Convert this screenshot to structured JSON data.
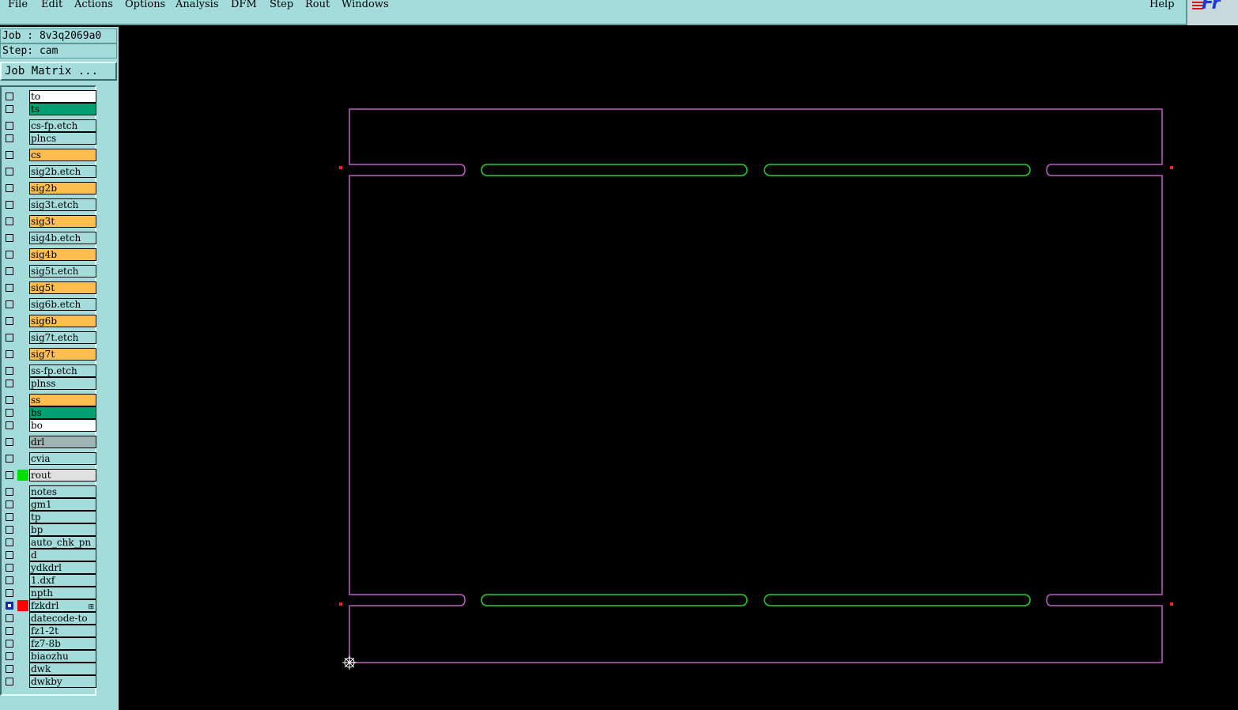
{
  "menubar": {
    "items": [
      "File",
      "Edit",
      "Actions",
      "Options",
      "Analysis",
      "DFM",
      "Step",
      "Rout",
      "Windows"
    ],
    "help": "Help",
    "logo": "Fr"
  },
  "job": {
    "label": "Job : 8v3q2069a0"
  },
  "step": {
    "label": "Step: cam"
  },
  "job_matrix_button": "Job Matrix ...",
  "layers": [
    {
      "name": "to",
      "color": "#ffffff"
    },
    {
      "name": "ts",
      "color": "#00a070"
    },
    {
      "name": "cs-fp.etch",
      "color": "#a4dcdc"
    },
    {
      "name": "plncs",
      "color": "#a4dcdc"
    },
    {
      "name": "cs",
      "color": "#ffbe50"
    },
    {
      "name": "sig2b.etch",
      "color": "#a4dcdc"
    },
    {
      "name": "sig2b",
      "color": "#ffbe50"
    },
    {
      "name": "sig3t.etch",
      "color": "#a4dcdc"
    },
    {
      "name": "sig3t",
      "color": "#ffbe50"
    },
    {
      "name": "sig4b.etch",
      "color": "#a4dcdc"
    },
    {
      "name": "sig4b",
      "color": "#ffbe50"
    },
    {
      "name": "sig5t.etch",
      "color": "#a4dcdc"
    },
    {
      "name": "sig5t",
      "color": "#ffbe50"
    },
    {
      "name": "sig6b.etch",
      "color": "#a4dcdc"
    },
    {
      "name": "sig6b",
      "color": "#ffbe50"
    },
    {
      "name": "sig7t.etch",
      "color": "#a4dcdc"
    },
    {
      "name": "sig7t",
      "color": "#ffbe50"
    },
    {
      "name": "ss-fp.etch",
      "color": "#a4dcdc"
    },
    {
      "name": "plnss",
      "color": "#a4dcdc"
    },
    {
      "name": "ss",
      "color": "#ffbe50"
    },
    {
      "name": "bs",
      "color": "#00a070"
    },
    {
      "name": "bo",
      "color": "#ffffff"
    },
    {
      "name": "drl",
      "color": "#a0b4b4"
    },
    {
      "name": "cvia",
      "color": "#a4dcdc"
    },
    {
      "name": "rout",
      "color": "#e0e0e0",
      "swatch": "#00e000"
    },
    {
      "name": "notes",
      "color": "#a4dcdc"
    },
    {
      "name": "gm1",
      "color": "#a4dcdc"
    },
    {
      "name": "tp",
      "color": "#a4dcdc"
    },
    {
      "name": "bp",
      "color": "#a4dcdc"
    },
    {
      "name": "auto_chk_pn",
      "color": "#a4dcdc"
    },
    {
      "name": "d",
      "color": "#a4dcdc"
    },
    {
      "name": "ydkdrl",
      "color": "#a4dcdc"
    },
    {
      "name": "1.dxf",
      "color": "#a4dcdc"
    },
    {
      "name": "npth",
      "color": "#a4dcdc"
    },
    {
      "name": "fzkdrl",
      "color": "#a4dcdc",
      "swatch": "#ff0000",
      "selected": true
    },
    {
      "name": "datecode-to",
      "color": "#a4dcdc"
    },
    {
      "name": "fz1-2t",
      "color": "#a4dcdc"
    },
    {
      "name": "fz7-8b",
      "color": "#a4dcdc"
    },
    {
      "name": "biaozhu",
      "color": "#a4dcdc"
    },
    {
      "name": "dwk",
      "color": "#a4dcdc"
    },
    {
      "name": "dwkby",
      "color": "#a4dcdc"
    }
  ],
  "colors": {
    "outline": "#c060c0",
    "slot": "#30d030",
    "marker": "#ff2020",
    "origin": "#ffffff"
  }
}
